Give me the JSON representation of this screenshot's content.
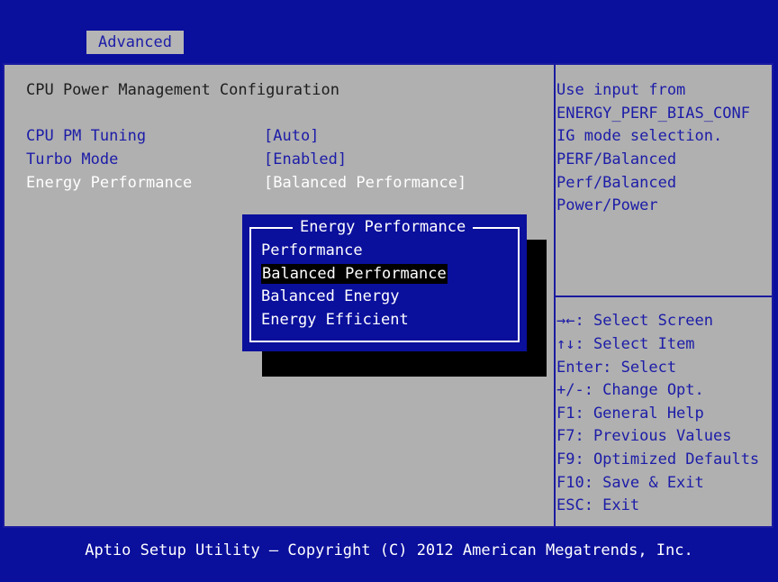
{
  "tabs": {
    "active": "Advanced"
  },
  "page": {
    "title": "CPU Power Management Configuration",
    "settings": [
      {
        "label": "CPU PM Tuning",
        "value": "[Auto]"
      },
      {
        "label": "Turbo Mode",
        "value": "[Enabled]"
      },
      {
        "label": "Energy Performance",
        "value": "[Balanced Performance]"
      }
    ]
  },
  "help": {
    "lines": [
      "Use input from",
      "ENERGY_PERF_BIAS_CONF",
      "IG mode selection.",
      "PERF/Balanced",
      "Perf/Balanced",
      "Power/Power"
    ]
  },
  "keys": [
    {
      "key": "→←",
      "desc": ": Select Screen"
    },
    {
      "key": "↑↓",
      "desc": ": Select Item"
    },
    {
      "key": "",
      "desc": "Enter: Select"
    },
    {
      "key": "",
      "desc": "+/-: Change Opt."
    },
    {
      "key": "",
      "desc": "F1: General Help"
    },
    {
      "key": "",
      "desc": "F7: Previous Values"
    },
    {
      "key": "",
      "desc": "F9: Optimized Defaults"
    },
    {
      "key": "",
      "desc": "F10: Save & Exit"
    },
    {
      "key": "",
      "desc": "ESC: Exit"
    }
  ],
  "popup": {
    "title": "Energy Performance",
    "options": [
      "Performance",
      "Balanced Performance",
      "Balanced Energy",
      "Energy Efficient"
    ],
    "selected_index": 1
  },
  "footer": "Aptio Setup Utility – Copyright (C) 2012 American Megatrends, Inc.",
  "colors": {
    "background": "#0a0f9c",
    "panel": "#b0b0b0",
    "accent": "#1c1ca8",
    "selection": "#000000"
  }
}
